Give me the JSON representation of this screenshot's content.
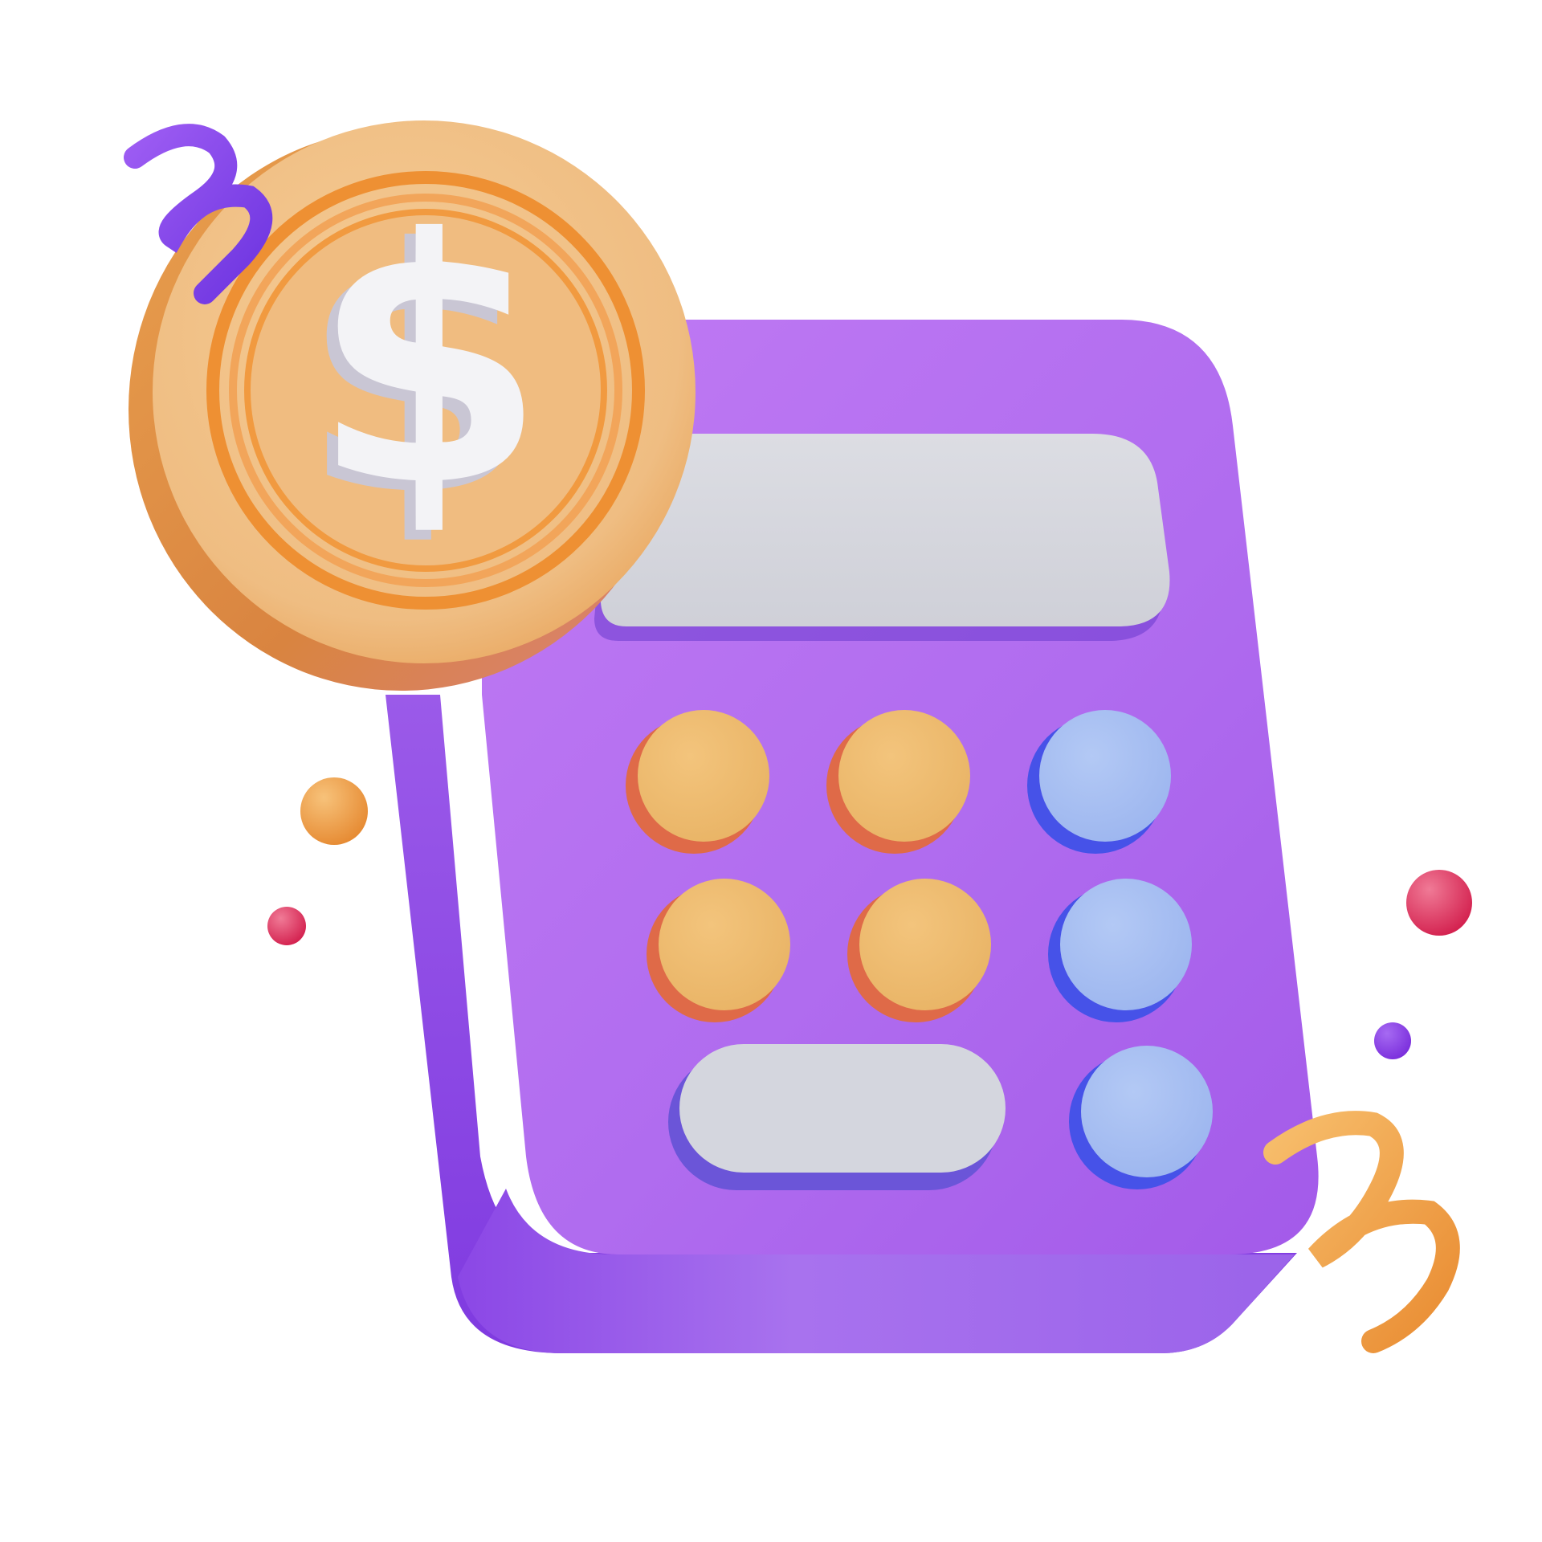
{
  "illustration": {
    "coin": {
      "symbol": "$"
    },
    "colors": {
      "background": "#ffffff",
      "calculator_body": "#b070f0",
      "calculator_side": "#8f4be6",
      "calculator_bottom": "#a46ceb",
      "screen": "#d7d8de",
      "key_orange": "#eebc72",
      "key_orange_side": "#e0704a",
      "key_blue": "#a8c0f2",
      "key_blue_side": "#4a55e8",
      "key_wide": "#d4d6de",
      "coin_face": "#f3c488",
      "coin_rim": "#e98a2e",
      "coin_symbol": "#f2f2f5",
      "squiggle_purple": "#8a4bef",
      "squiggle_orange": "#f3a54a",
      "orb_orange": "#f0a04a",
      "orb_pink": "#e0426a",
      "orb_purple": "#8a3fe6"
    },
    "icons": [
      "calculator-icon",
      "dollar-coin-icon",
      "squiggle-decoration",
      "orb-decoration"
    ]
  }
}
